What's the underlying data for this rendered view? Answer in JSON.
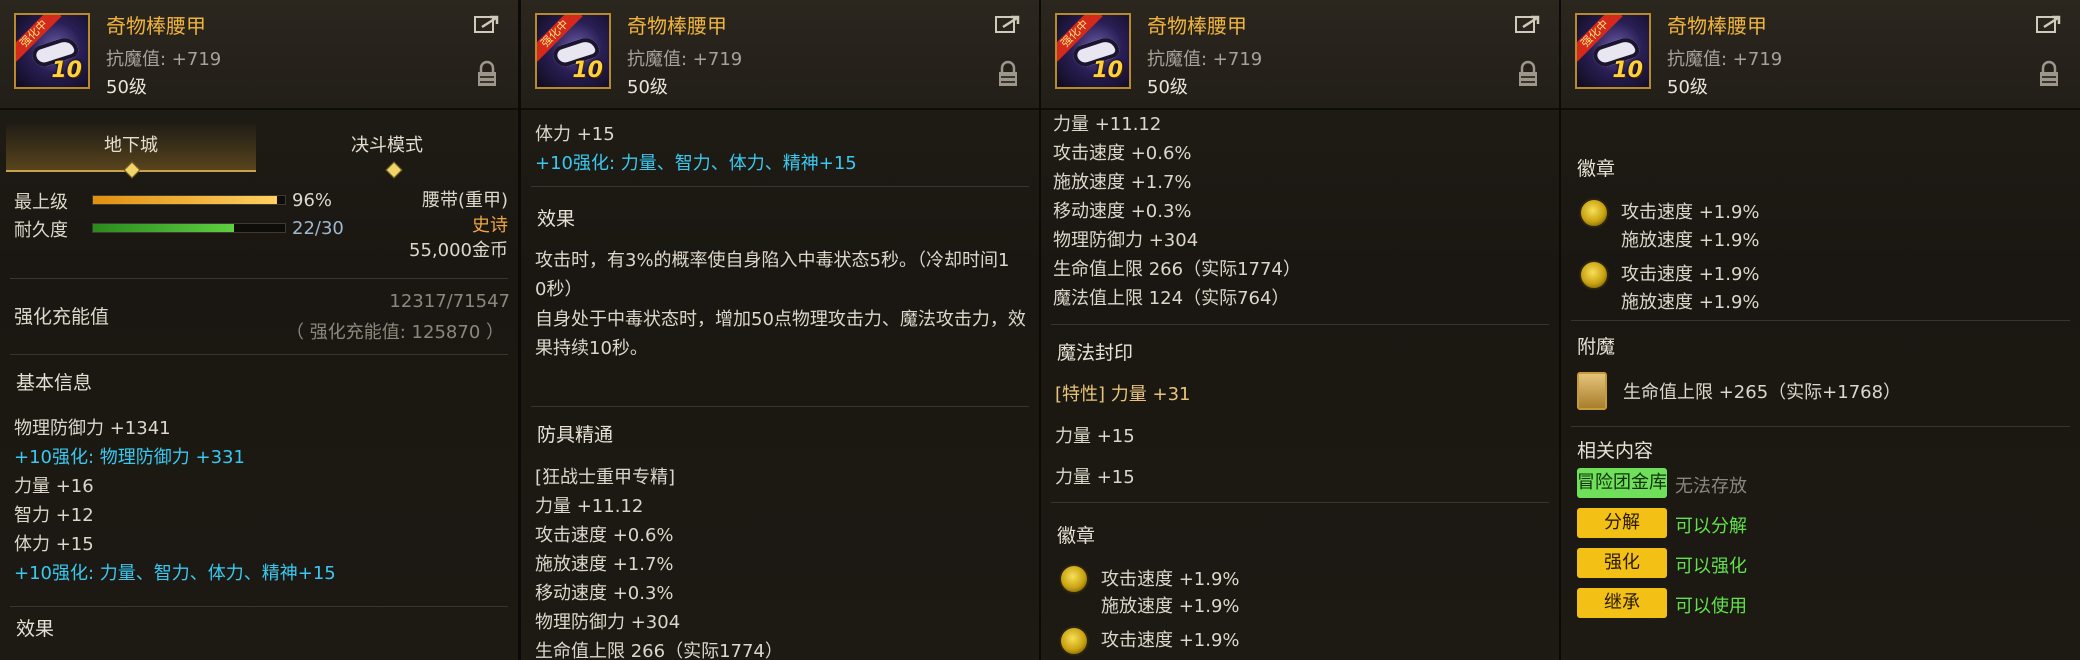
{
  "item": {
    "name": "奇物棒腰甲",
    "magic_resist": "抗魔值: +719",
    "level": "50级",
    "icon_badge": "强化中",
    "icon_level": "10"
  },
  "panel1": {
    "tabs": [
      "地下城",
      "决斗模式"
    ],
    "grade_label": "最上级",
    "grade_value": "96%",
    "grade_fill": 0.96,
    "durability_label": "耐久度",
    "durability_value": "22/30",
    "durability_fill": 0.7333,
    "type": "腰带(重甲)",
    "rarity": "史诗",
    "price": "55,000金币",
    "charge_label": "强化充能值",
    "charge_value": "12317/71547",
    "charge_note": "（ 强化充能值: 125870 ）",
    "basic_info_title": "基本信息",
    "stats": [
      {
        "text": "物理防御力 +1341",
        "style": "normal"
      },
      {
        "text": "+10强化: 物理防御力 +331",
        "style": "cyan"
      },
      {
        "text": "力量 +16",
        "style": "normal"
      },
      {
        "text": "智力 +12",
        "style": "normal"
      },
      {
        "text": "体力 +15",
        "style": "normal"
      },
      {
        "text": "+10强化: 力量、智力、体力、精神+15",
        "style": "cyan"
      }
    ],
    "effect_title": "效果"
  },
  "panel2": {
    "top_lines": [
      {
        "text": "体力 +15",
        "style": "normal"
      },
      {
        "text": "+10强化: 力量、智力、体力、精神+15",
        "style": "cyan"
      }
    ],
    "effect_title": "效果",
    "effect_lines": [
      "攻击时，有3%的概率使自身陷入中毒状态5秒。（冷却时间1",
      "0秒）",
      "自身处于中毒状态时，增加50点物理攻击力、魔法攻击力，效",
      "果持续10秒。"
    ],
    "mastery_title": "防具精通",
    "mastery_lines": [
      "[狂战士重甲专精]",
      "力量 +11.12",
      "攻击速度 +0.6%",
      "施放速度 +1.7%",
      "移动速度 +0.3%",
      "物理防御力 +304",
      "生命值上限 266（实际1774）"
    ]
  },
  "panel3": {
    "top_lines": [
      "力量 +11.12",
      "攻击速度 +0.6%",
      "施放速度 +1.7%",
      "移动速度 +0.3%",
      "物理防御力 +304",
      "生命值上限 266（实际1774）",
      "魔法值上限 124（实际764）"
    ],
    "seal_title": "魔法封印",
    "seal_lines": [
      {
        "text": "[特性] 力量 +31",
        "style": "gold"
      },
      {
        "text": "力量 +15",
        "style": "normal"
      },
      {
        "text": "力量 +15",
        "style": "normal"
      }
    ],
    "emblem_title": "徽章",
    "emblems": [
      [
        "攻击速度 +1.9%",
        "施放速度 +1.9%"
      ],
      [
        "攻击速度 +1.9%",
        ""
      ]
    ]
  },
  "panel4": {
    "emblem_title": "徽章",
    "emblems": [
      [
        "攻击速度 +1.9%",
        "施放速度 +1.9%"
      ],
      [
        "攻击速度 +1.9%",
        "施放速度 +1.9%"
      ]
    ],
    "enchant_title": "附魔",
    "enchant_text": "生命值上限 +265（实际+1768）",
    "related_title": "相关内容",
    "related": [
      {
        "button": "冒险团金库",
        "status": "无法存放",
        "button_style": "green",
        "status_style": "dim"
      },
      {
        "button": "分解",
        "status": "可以分解",
        "button_style": "yellow",
        "status_style": "green"
      },
      {
        "button": "强化",
        "status": "可以强化",
        "button_style": "yellow",
        "status_style": "green"
      },
      {
        "button": "继承",
        "status": "可以使用",
        "button_style": "yellow",
        "status_style": "green"
      }
    ]
  },
  "colors": {
    "gold_name": "#f0b43c",
    "cyan_enhance": "#39c8f0",
    "green_status": "#62e24a",
    "grade_bar": "#f0a020",
    "durability_bar": "#3ea82a"
  }
}
